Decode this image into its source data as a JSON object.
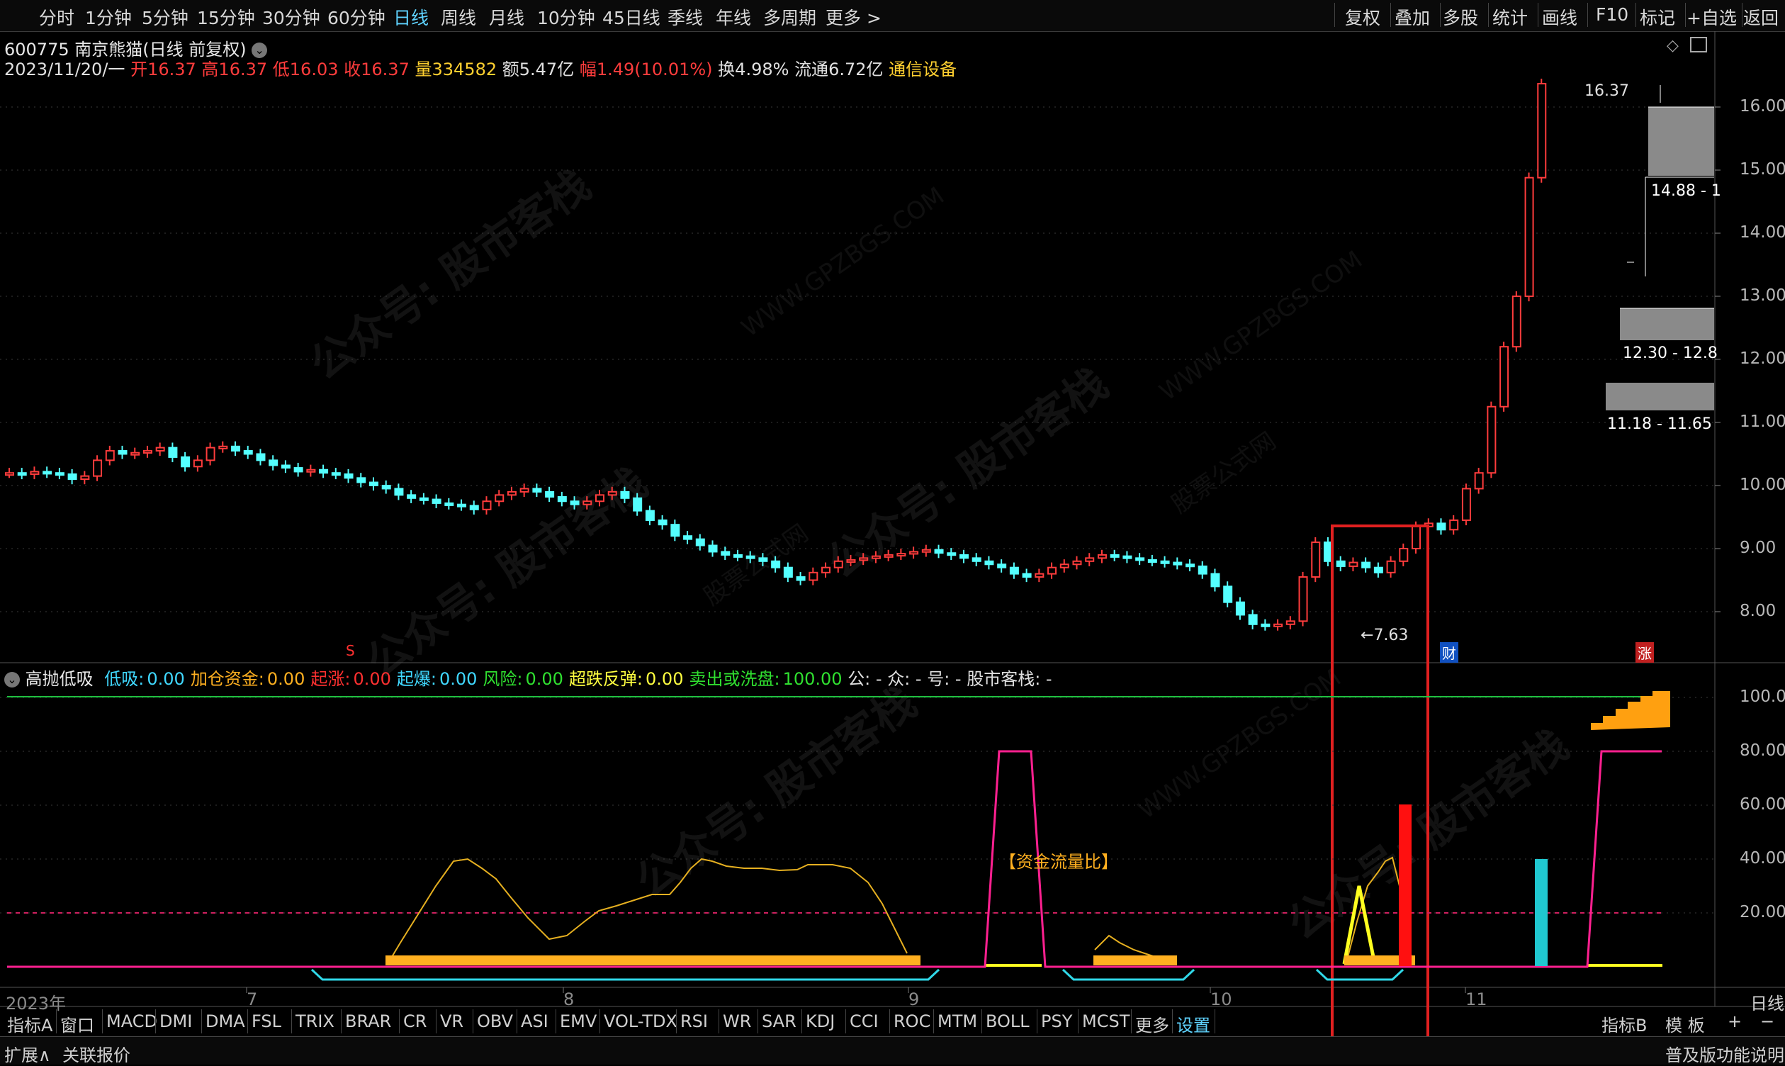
{
  "toolbar": {
    "periods": [
      "分时",
      "1分钟",
      "5分钟",
      "15分钟",
      "30分钟",
      "60分钟",
      "日线",
      "周线",
      "月线",
      "10分钟",
      "45日线",
      "季线",
      "年线",
      "多周期",
      "更多 >"
    ],
    "active_period": "日线",
    "right_buttons": [
      "复权",
      "叠加",
      "多股",
      "统计",
      "画线",
      "F10",
      "标记",
      "+自选",
      "返回"
    ]
  },
  "stock": {
    "title": "600775 南京熊猫(日线 前复权)",
    "date": "2023/11/20/一",
    "open_label": "开",
    "open": "16.37",
    "high_label": "高",
    "high": "16.37",
    "low_label": "低",
    "low": "16.03",
    "close_label": "收",
    "close": "16.37",
    "vol_label": "量",
    "vol": "334582",
    "amount_label": "额",
    "amount": "5.47亿",
    "range_label": "幅",
    "range": "1.49(10.01%)",
    "turnover_label": "换",
    "turnover": "4.98%",
    "float_label": "流通",
    "float": "6.72亿",
    "sector": "通信设备"
  },
  "price_axis": [
    "16.00",
    "15.00",
    "14.00",
    "13.00",
    "12.00",
    "11.00",
    "10.00",
    "9.00",
    "8.00"
  ],
  "price_annotations": {
    "high_mark": "16.37",
    "low_mark": "7.63",
    "zone1": "14.88 - 1",
    "zone2": "12.30 - 12.8",
    "zone3": "11.18 - 11.65",
    "badge_cai": "财",
    "badge_zhang": "涨",
    "badge_s": "S"
  },
  "indicator": {
    "name": "高抛低吸",
    "items": [
      {
        "label": "低吸:",
        "value": "0.00",
        "color": "#40d8ff"
      },
      {
        "label": "加仓资金:",
        "value": "0.00",
        "color": "#ffb020"
      },
      {
        "label": "起涨:",
        "value": "0.00",
        "color": "#ff3030"
      },
      {
        "label": "起爆:",
        "value": "0.00",
        "color": "#40d8ff"
      },
      {
        "label": "风险:",
        "value": "0.00",
        "color": "#30e030"
      },
      {
        "label": "超跌反弹:",
        "value": "0.00",
        "color": "#ffff40"
      },
      {
        "label": "卖出或洗盘:",
        "value": "100.00",
        "color": "#30e030"
      }
    ],
    "extra": "公: -  众: -  号: -  股市客栈: -",
    "axis": [
      "100.00",
      "80.00",
      "60.00",
      "40.00",
      "20.00"
    ],
    "annotation": "【资金流量比】"
  },
  "dates": {
    "year": "2023年",
    "months": [
      "7",
      "8",
      "9",
      "10",
      "11"
    ],
    "axis_unit": "日线"
  },
  "bottom_tabs": [
    "指标A",
    "窗口",
    "MACD",
    "DMI",
    "DMA",
    "FSL",
    "TRIX",
    "BRAR",
    "CR",
    "VR",
    "OBV",
    "ASI",
    "EMV",
    "VOL-TDX",
    "RSI",
    "WR",
    "SAR",
    "KDJ",
    "CCI",
    "ROC",
    "MTM",
    "BOLL",
    "PSY",
    "MCST",
    "更多",
    "设置"
  ],
  "bottom_right": [
    "指标B",
    "模 板",
    "+",
    "−"
  ],
  "status": {
    "left1": "扩展∧",
    "left2": "关联报价",
    "right": "普及版功能说明"
  },
  "watermarks": [
    "公众号: 股市客栈",
    "WWW.GPZBGS.COM",
    "股票公式网"
  ],
  "colors": {
    "up": "#ff3c3c",
    "down": "#54ffff",
    "accent": "#5fd3ff",
    "highlight_box": "#e02020"
  }
}
